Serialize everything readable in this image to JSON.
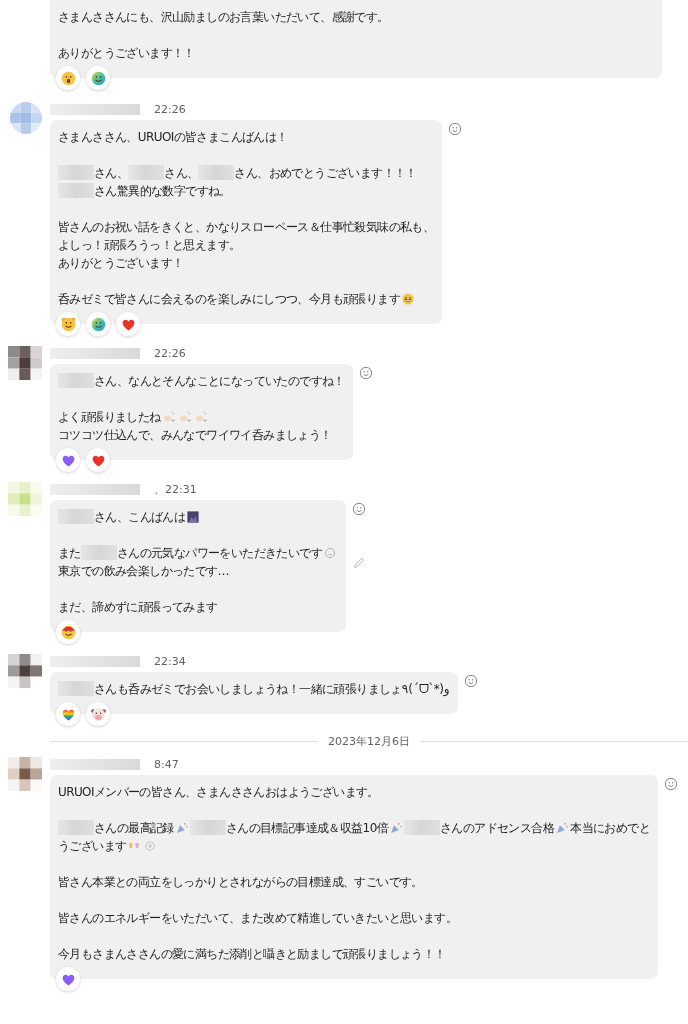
{
  "messages": [
    {
      "paragraphs": [
        [
          [
            {
              "text": "さまんささんにも、沢山励ましのお言葉いただいて、感謝です。"
            }
          ]
        ],
        [
          [
            {
              "text": "ありがとうございます！！"
            }
          ]
        ]
      ],
      "reactions": [
        {
          "kind": "surprised"
        },
        {
          "kind": "rainbow-smile"
        }
      ]
    },
    {
      "time": "22:26",
      "react_icon": true,
      "paragraphs": [
        [
          [
            {
              "text": "さまんささん、URUOIの皆さまこんばんは！"
            }
          ]
        ],
        [
          [
            {
              "kind": "redacted"
            },
            {
              "text": "さん、"
            },
            {
              "kind": "redacted"
            },
            {
              "text": "さん、"
            },
            {
              "kind": "redacted"
            },
            {
              "text": "さん、おめでとうございます！！！"
            }
          ],
          [
            {
              "kind": "redacted"
            },
            {
              "text": "さん驚異的な数字ですね。"
            }
          ]
        ],
        [
          [
            {
              "text": "皆さんのお祝い話をきくと、かなりスローペース＆仕事忙殺気味の私も、"
            }
          ],
          [
            {
              "text": "よしっ！頑張ろうっ！と思えます。"
            }
          ],
          [
            {
              "text": "ありがとうございます！"
            }
          ]
        ],
        [
          [
            {
              "text": "呑みゼミで皆さんに会えるのを楽しみにしつつ、今月も頑張ります"
            },
            {
              "kind": "grin"
            }
          ]
        ]
      ],
      "reactions": [
        {
          "kind": "bear-smile"
        },
        {
          "kind": "rainbow-smile"
        },
        {
          "kind": "heart",
          "color": "#e8322b"
        }
      ]
    },
    {
      "time": "22:26",
      "react_icon": true,
      "paragraphs": [
        [
          [
            {
              "kind": "redacted"
            },
            {
              "text": "さん、なんとそんなことになっていたのですね！"
            }
          ]
        ],
        [
          [
            {
              "text": "よく頑張りましたね"
            },
            {
              "kind": "clap"
            },
            {
              "kind": "clap"
            },
            {
              "kind": "clap"
            }
          ],
          [
            {
              "text": "コツコツ仕込んで、みんなでワイワイ呑みましょう！"
            }
          ]
        ]
      ],
      "reactions": [
        {
          "kind": "heart",
          "color": "#8b5cf6"
        },
        {
          "kind": "heart",
          "color": "#e8322b"
        }
      ]
    },
    {
      "time": "、22:31",
      "react_icon": true,
      "edit_icon": true,
      "paragraphs": [
        [
          [
            {
              "kind": "redacted"
            },
            {
              "text": "さん、こんばんは"
            },
            {
              "kind": "night"
            }
          ]
        ],
        [
          [
            {
              "text": "また"
            },
            {
              "kind": "redacted"
            },
            {
              "text": "さんの元気なパワーをいただきたいです"
            },
            {
              "kind": "smile"
            }
          ],
          [
            {
              "text": "東京での飲み会楽しかったです…"
            }
          ]
        ],
        [
          [
            {
              "text": "まだ、諦めずに頑張ってみます"
            }
          ]
        ]
      ],
      "reactions": [
        {
          "kind": "santa"
        }
      ]
    },
    {
      "time": "22:34",
      "react_icon": true,
      "paragraphs": [
        [
          [
            {
              "kind": "redacted"
            },
            {
              "text": "さんも呑みゼミでお会いしましょうね！一緒に頑張りましょ٩(ˊᗜˋ*)و"
            }
          ]
        ]
      ],
      "reactions": [
        {
          "kind": "rainbow-heart"
        },
        {
          "kind": "cow"
        }
      ]
    },
    {
      "date": "2023年12月6日",
      "time": "8:47",
      "react_icon": true,
      "paragraphs": [
        [
          [
            {
              "text": "URUOIメンバーの皆さん、さまんささんおはようございます。"
            }
          ]
        ],
        [
          [
            {
              "kind": "redacted"
            },
            {
              "text": "さんの最高記録"
            },
            {
              "kind": "party"
            },
            {
              "kind": "redacted"
            },
            {
              "text": "さんの目標記事達成＆収益10倍"
            },
            {
              "kind": "party"
            },
            {
              "kind": "redacted"
            },
            {
              "text": "さんのアドセンス合格"
            },
            {
              "kind": "party"
            },
            {
              "text": "本当におめでと"
            }
          ],
          [
            {
              "text": "うございます"
            },
            {
              "kind": "cheers"
            },
            {
              "kind": "seal"
            }
          ]
        ],
        [
          [
            {
              "text": "皆さん本業との両立をしっかりとされながらの目標達成、すごいです。"
            }
          ]
        ],
        [
          [
            {
              "text": "皆さんのエネルギーをいただいて、また改めて精進していきたいと思います。"
            }
          ]
        ],
        [
          [
            {
              "text": "今月もさまんささんの愛に満ちた添削と囁きと励ましで頑張りましょう！！"
            }
          ]
        ]
      ],
      "reactions": [
        {
          "kind": "heart",
          "color": "#8b5cf6"
        }
      ]
    }
  ]
}
